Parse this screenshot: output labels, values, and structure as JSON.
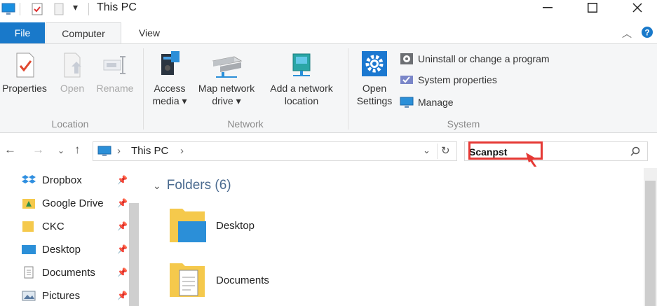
{
  "window": {
    "title": "This PC"
  },
  "ribbon_tabs": {
    "file": "File",
    "computer": "Computer",
    "view": "View"
  },
  "ribbon": {
    "location": {
      "label": "Location",
      "properties": "Properties",
      "open": "Open",
      "rename": "Rename"
    },
    "network": {
      "label": "Network",
      "access_media_1": "Access",
      "access_media_2": "media ▾",
      "map_drive_1": "Map network",
      "map_drive_2": "drive ▾",
      "add_location_1": "Add a network",
      "add_location_2": "location"
    },
    "system": {
      "label": "System",
      "open_settings_1": "Open",
      "open_settings_2": "Settings",
      "uninstall": "Uninstall or change a program",
      "system_properties": "System properties",
      "manage": "Manage"
    }
  },
  "address_bar": {
    "path": "This PC",
    "separator": "›"
  },
  "search": {
    "value": "Scanpst"
  },
  "sidebar": {
    "items": [
      {
        "label": "Dropbox"
      },
      {
        "label": "Google Drive"
      },
      {
        "label": "CKC"
      },
      {
        "label": "Desktop"
      },
      {
        "label": "Documents"
      },
      {
        "label": "Pictures"
      }
    ]
  },
  "content": {
    "section_title": "Folders (6)",
    "folders": [
      {
        "name": "Desktop"
      },
      {
        "name": "Documents"
      }
    ]
  },
  "colors": {
    "accent": "#1979ca",
    "highlight": "#e53935",
    "folder_yellow": "#f5c94c",
    "folder_blue": "#2b8fd8"
  }
}
